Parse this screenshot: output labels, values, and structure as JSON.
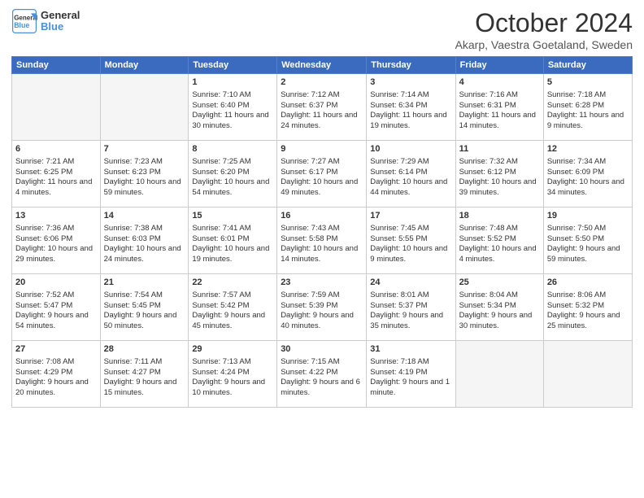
{
  "header": {
    "logo_line1": "General",
    "logo_line2": "Blue",
    "month": "October 2024",
    "location": "Akarp, Vaestra Goetaland, Sweden"
  },
  "weekdays": [
    "Sunday",
    "Monday",
    "Tuesday",
    "Wednesday",
    "Thursday",
    "Friday",
    "Saturday"
  ],
  "weeks": [
    [
      {
        "day": "",
        "content": ""
      },
      {
        "day": "",
        "content": ""
      },
      {
        "day": "1",
        "content": "Sunrise: 7:10 AM\nSunset: 6:40 PM\nDaylight: 11 hours and 30 minutes."
      },
      {
        "day": "2",
        "content": "Sunrise: 7:12 AM\nSunset: 6:37 PM\nDaylight: 11 hours and 24 minutes."
      },
      {
        "day": "3",
        "content": "Sunrise: 7:14 AM\nSunset: 6:34 PM\nDaylight: 11 hours and 19 minutes."
      },
      {
        "day": "4",
        "content": "Sunrise: 7:16 AM\nSunset: 6:31 PM\nDaylight: 11 hours and 14 minutes."
      },
      {
        "day": "5",
        "content": "Sunrise: 7:18 AM\nSunset: 6:28 PM\nDaylight: 11 hours and 9 minutes."
      }
    ],
    [
      {
        "day": "6",
        "content": "Sunrise: 7:21 AM\nSunset: 6:25 PM\nDaylight: 11 hours and 4 minutes."
      },
      {
        "day": "7",
        "content": "Sunrise: 7:23 AM\nSunset: 6:23 PM\nDaylight: 10 hours and 59 minutes."
      },
      {
        "day": "8",
        "content": "Sunrise: 7:25 AM\nSunset: 6:20 PM\nDaylight: 10 hours and 54 minutes."
      },
      {
        "day": "9",
        "content": "Sunrise: 7:27 AM\nSunset: 6:17 PM\nDaylight: 10 hours and 49 minutes."
      },
      {
        "day": "10",
        "content": "Sunrise: 7:29 AM\nSunset: 6:14 PM\nDaylight: 10 hours and 44 minutes."
      },
      {
        "day": "11",
        "content": "Sunrise: 7:32 AM\nSunset: 6:12 PM\nDaylight: 10 hours and 39 minutes."
      },
      {
        "day": "12",
        "content": "Sunrise: 7:34 AM\nSunset: 6:09 PM\nDaylight: 10 hours and 34 minutes."
      }
    ],
    [
      {
        "day": "13",
        "content": "Sunrise: 7:36 AM\nSunset: 6:06 PM\nDaylight: 10 hours and 29 minutes."
      },
      {
        "day": "14",
        "content": "Sunrise: 7:38 AM\nSunset: 6:03 PM\nDaylight: 10 hours and 24 minutes."
      },
      {
        "day": "15",
        "content": "Sunrise: 7:41 AM\nSunset: 6:01 PM\nDaylight: 10 hours and 19 minutes."
      },
      {
        "day": "16",
        "content": "Sunrise: 7:43 AM\nSunset: 5:58 PM\nDaylight: 10 hours and 14 minutes."
      },
      {
        "day": "17",
        "content": "Sunrise: 7:45 AM\nSunset: 5:55 PM\nDaylight: 10 hours and 9 minutes."
      },
      {
        "day": "18",
        "content": "Sunrise: 7:48 AM\nSunset: 5:52 PM\nDaylight: 10 hours and 4 minutes."
      },
      {
        "day": "19",
        "content": "Sunrise: 7:50 AM\nSunset: 5:50 PM\nDaylight: 9 hours and 59 minutes."
      }
    ],
    [
      {
        "day": "20",
        "content": "Sunrise: 7:52 AM\nSunset: 5:47 PM\nDaylight: 9 hours and 54 minutes."
      },
      {
        "day": "21",
        "content": "Sunrise: 7:54 AM\nSunset: 5:45 PM\nDaylight: 9 hours and 50 minutes."
      },
      {
        "day": "22",
        "content": "Sunrise: 7:57 AM\nSunset: 5:42 PM\nDaylight: 9 hours and 45 minutes."
      },
      {
        "day": "23",
        "content": "Sunrise: 7:59 AM\nSunset: 5:39 PM\nDaylight: 9 hours and 40 minutes."
      },
      {
        "day": "24",
        "content": "Sunrise: 8:01 AM\nSunset: 5:37 PM\nDaylight: 9 hours and 35 minutes."
      },
      {
        "day": "25",
        "content": "Sunrise: 8:04 AM\nSunset: 5:34 PM\nDaylight: 9 hours and 30 minutes."
      },
      {
        "day": "26",
        "content": "Sunrise: 8:06 AM\nSunset: 5:32 PM\nDaylight: 9 hours and 25 minutes."
      }
    ],
    [
      {
        "day": "27",
        "content": "Sunrise: 7:08 AM\nSunset: 4:29 PM\nDaylight: 9 hours and 20 minutes."
      },
      {
        "day": "28",
        "content": "Sunrise: 7:11 AM\nSunset: 4:27 PM\nDaylight: 9 hours and 15 minutes."
      },
      {
        "day": "29",
        "content": "Sunrise: 7:13 AM\nSunset: 4:24 PM\nDaylight: 9 hours and 10 minutes."
      },
      {
        "day": "30",
        "content": "Sunrise: 7:15 AM\nSunset: 4:22 PM\nDaylight: 9 hours and 6 minutes."
      },
      {
        "day": "31",
        "content": "Sunrise: 7:18 AM\nSunset: 4:19 PM\nDaylight: 9 hours and 1 minute."
      },
      {
        "day": "",
        "content": ""
      },
      {
        "day": "",
        "content": ""
      }
    ]
  ]
}
